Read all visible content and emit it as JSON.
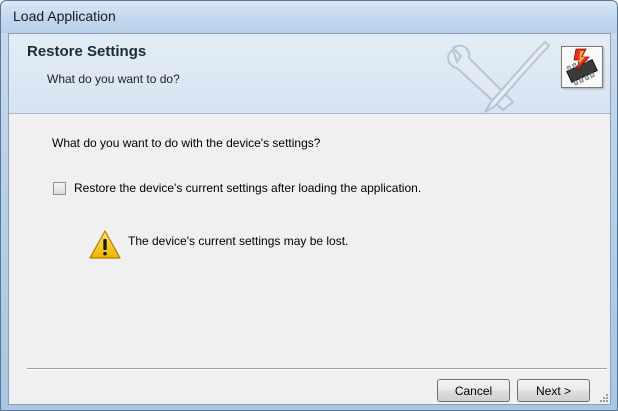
{
  "window": {
    "title": "Load Application"
  },
  "header": {
    "title": "Restore Settings",
    "subtitle": "What do you want to do?",
    "icon": "chip-with-lightning-icon",
    "watermark_icon": "wrench-screwdriver-icon"
  },
  "content": {
    "question": "What do you want to do with the device's settings?",
    "checkbox": {
      "label": "Restore the device's current settings after loading the application.",
      "checked": false
    },
    "warning": {
      "icon": "warning-triangle-icon",
      "text": "The device's current settings may be lost."
    }
  },
  "buttons": {
    "cancel": "Cancel",
    "next": "Next >"
  },
  "colors": {
    "window_frame": "#b9d1ea",
    "header_bg": "#dde8f4",
    "warning_yellow": "#f7c600",
    "client_bg": "#f0f0f0"
  }
}
